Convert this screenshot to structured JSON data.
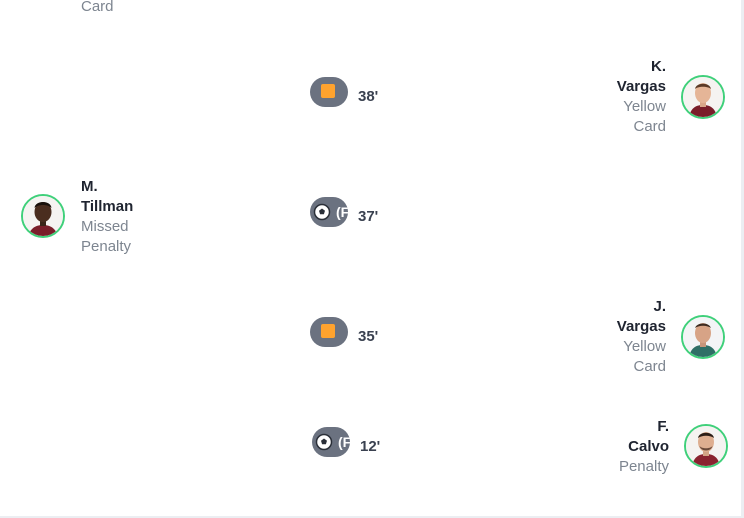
{
  "top_partial": {
    "event": "Card"
  },
  "timeline": [
    {
      "minute": "38'",
      "icon": "yellow-card-icon",
      "side": "right",
      "player": "K.\nVargas",
      "event": "Yellow\nCard"
    },
    {
      "minute": "37'",
      "icon": "soccer-ball-icon",
      "pill_overflow_text": "(F",
      "side": "left",
      "player": "M.\nTillman",
      "event": "Missed\nPenalty"
    },
    {
      "minute": "35'",
      "icon": "yellow-card-icon",
      "side": "right",
      "player": "J.\nVargas",
      "event": "Yellow\nCard"
    },
    {
      "minute": "12'",
      "icon": "soccer-ball-icon",
      "pill_overflow_text": "(F",
      "side": "right",
      "player": "F.\nCalvo",
      "event": "Penalty"
    }
  ],
  "colors": {
    "avatar_ring": "#3fd07a",
    "pill_bg": "#6b7280",
    "yellow_card": "#ffa32e",
    "muted_text": "#7d8590"
  }
}
